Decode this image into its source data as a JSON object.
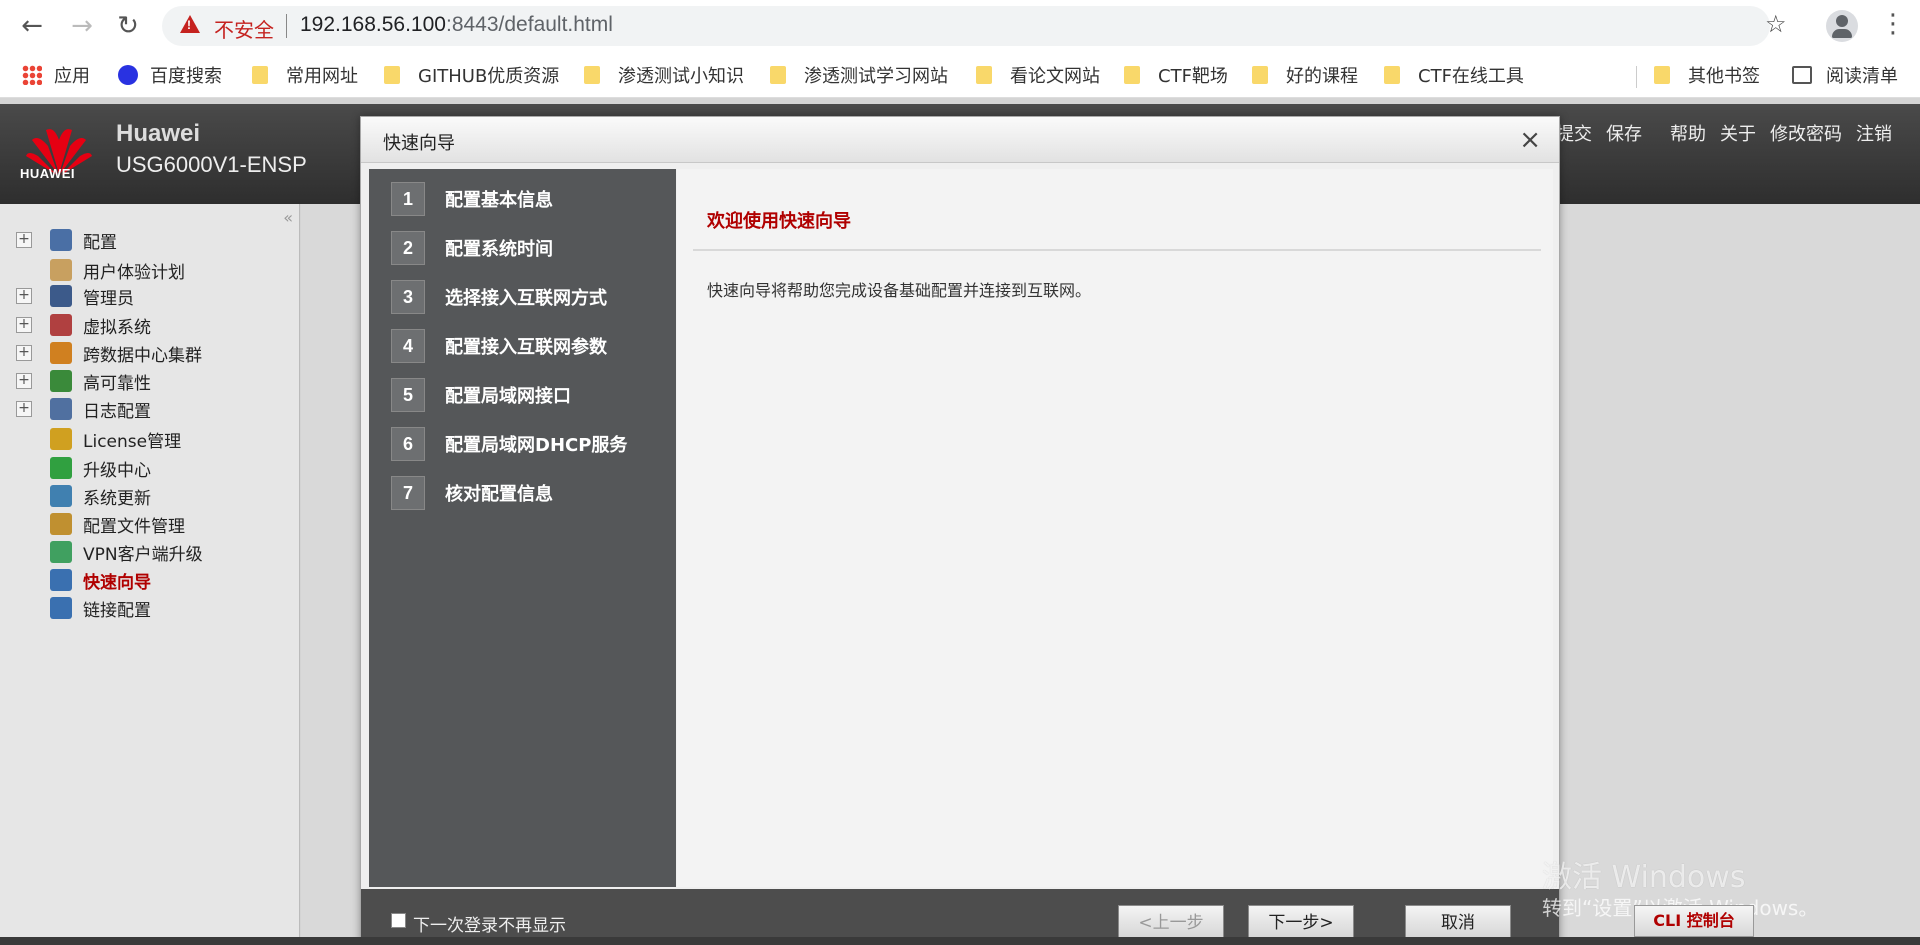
{
  "browser": {
    "insecure_label": "不安全",
    "url_host": "192.168.56.100",
    "url_rest": ":8443/default.html",
    "bookmarks": [
      "应用",
      "百度搜索",
      "常用网址",
      "GITHUB优质资源",
      "渗透测试小知识",
      "渗透测试学习网站",
      "看论文网站",
      "CTF靶场",
      "好的课程",
      "CTF在线工具",
      "其他书签",
      "阅读清单"
    ]
  },
  "header": {
    "logo_text": "HUAWEI",
    "brand": "Huawei",
    "model": "USG6000V1-ENSP",
    "links": [
      "提交",
      "保存",
      "帮助",
      "关于",
      "修改密码",
      "注销"
    ]
  },
  "sidebar": {
    "items": [
      {
        "label": "配置",
        "expandable": true,
        "icon": "config-icon",
        "color": "#4a6fa5"
      },
      {
        "label": "用户体验计划",
        "expandable": false,
        "icon": "user-experience-icon",
        "color": "#c8a060"
      },
      {
        "label": "管理员",
        "expandable": true,
        "icon": "admin-icon",
        "color": "#3c5a8a"
      },
      {
        "label": "虚拟系统",
        "expandable": true,
        "icon": "virtual-system-icon",
        "color": "#b04040"
      },
      {
        "label": "跨数据中心集群",
        "expandable": true,
        "icon": "cluster-icon",
        "color": "#d08020"
      },
      {
        "label": "高可靠性",
        "expandable": true,
        "icon": "reliability-icon",
        "color": "#3a8a3a"
      },
      {
        "label": "日志配置",
        "expandable": true,
        "icon": "log-icon",
        "color": "#5070a0"
      },
      {
        "label": "License管理",
        "expandable": false,
        "icon": "license-icon",
        "color": "#d0a020"
      },
      {
        "label": "升级中心",
        "expandable": false,
        "icon": "upgrade-icon",
        "color": "#30a040"
      },
      {
        "label": "系统更新",
        "expandable": false,
        "icon": "system-update-icon",
        "color": "#4080b0"
      },
      {
        "label": "配置文件管理",
        "expandable": false,
        "icon": "config-file-icon",
        "color": "#c09030"
      },
      {
        "label": "VPN客户端升级",
        "expandable": false,
        "icon": "vpn-icon",
        "color": "#40a060"
      },
      {
        "label": "快速向导",
        "expandable": false,
        "icon": "wizard-icon",
        "color": "#3a70b0",
        "active": true
      },
      {
        "label": "链接配置",
        "expandable": false,
        "icon": "link-config-icon",
        "color": "#3a70b0"
      }
    ]
  },
  "wizard": {
    "title": "快速向导",
    "steps": [
      {
        "num": "1",
        "label": "配置基本信息"
      },
      {
        "num": "2",
        "label": "配置系统时间"
      },
      {
        "num": "3",
        "label": "选择接入互联网方式"
      },
      {
        "num": "4",
        "label": "配置接入互联网参数"
      },
      {
        "num": "5",
        "label": "配置局域网接口"
      },
      {
        "num": "6",
        "label": "配置局域网DHCP服务"
      },
      {
        "num": "7",
        "label": "核对配置信息"
      }
    ],
    "welcome_title": "欢迎使用快速向导",
    "welcome_desc": "快速向导将帮助您完成设备基础配置并连接到互联网。",
    "dont_show_label": "下一次登录不再显示",
    "prev_label": "<上一步",
    "next_label": "下一步>",
    "cancel_label": "取消"
  },
  "watermark": {
    "line1": "激活 Windows",
    "line2": "转到“设置”以激活 Windows。"
  },
  "cli_label": "CLI 控制台"
}
